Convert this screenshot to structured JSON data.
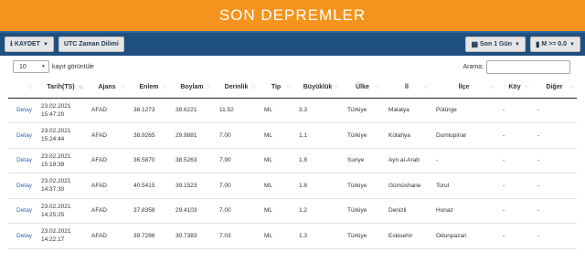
{
  "header": {
    "title": "SON DEPREMLER"
  },
  "toolbar": {
    "save_label": "KAYDET",
    "utc_label": "UTC Zaman Dilimi",
    "period_label": "Son 1 Gün",
    "magnitude_label": "M >= 0.0"
  },
  "controls": {
    "page_length": "10",
    "page_length_label": "kayıt görüntüle",
    "search_label": "Arama:",
    "search_value": ""
  },
  "table": {
    "headers": [
      "",
      "Tarih(TS)",
      "Ajans",
      "Enlem",
      "Boylam",
      "Derinlik",
      "Tip",
      "Büyüklük",
      "Ülke",
      "İl",
      "İlçe",
      "Köy",
      "Diğer"
    ],
    "rows": [
      {
        "link": "Detay",
        "date": "23.02.2021",
        "time": "15:47:20",
        "agency": "AFAD",
        "lat": "38.1273",
        "lon": "38.6221",
        "depth": "11.52",
        "type": "ML",
        "mag": "3.3",
        "country": "Türkiye",
        "province": "Malatya",
        "district": "Pütürge",
        "village": "-",
        "other": "-"
      },
      {
        "link": "Detay",
        "date": "23.02.2021",
        "time": "15:24:44",
        "agency": "AFAD",
        "lat": "38.9265",
        "lon": "29.9881",
        "depth": "7.00",
        "type": "ML",
        "mag": "1.1",
        "country": "Türkiye",
        "province": "Kütahya",
        "district": "Dumlupinar",
        "village": "-",
        "other": "-"
      },
      {
        "link": "Detay",
        "date": "23.02.2021",
        "time": "15:19:39",
        "agency": "AFAD",
        "lat": "36.5870",
        "lon": "38.5263",
        "depth": "7.90",
        "type": "ML",
        "mag": "1.8",
        "country": "Suriye",
        "province": "Ayn al-Arab",
        "district": "-",
        "village": "-",
        "other": "-"
      },
      {
        "link": "Detay",
        "date": "23.02.2021",
        "time": "14:37:30",
        "agency": "AFAD",
        "lat": "40.5415",
        "lon": "39.1523",
        "depth": "7.00",
        "type": "ML",
        "mag": "1.8",
        "country": "Türkiye",
        "province": "Gümüshane",
        "district": "Torul",
        "village": "-",
        "other": "-"
      },
      {
        "link": "Detay",
        "date": "23.02.2021",
        "time": "14:25:25",
        "agency": "AFAD",
        "lat": "37.8358",
        "lon": "29.4103",
        "depth": "7.00",
        "type": "ML",
        "mag": "1.2",
        "country": "Türkiye",
        "province": "Denizli",
        "district": "Honaz",
        "village": "-",
        "other": "-"
      },
      {
        "link": "Detay",
        "date": "23.02.2021",
        "time": "14:22:17",
        "agency": "AFAD",
        "lat": "39.7286",
        "lon": "30.7383",
        "depth": "7.03",
        "type": "ML",
        "mag": "1.3",
        "country": "Türkiye",
        "province": "Eskisehir",
        "district": "Odunpazari",
        "village": "-",
        "other": "-"
      }
    ]
  }
}
